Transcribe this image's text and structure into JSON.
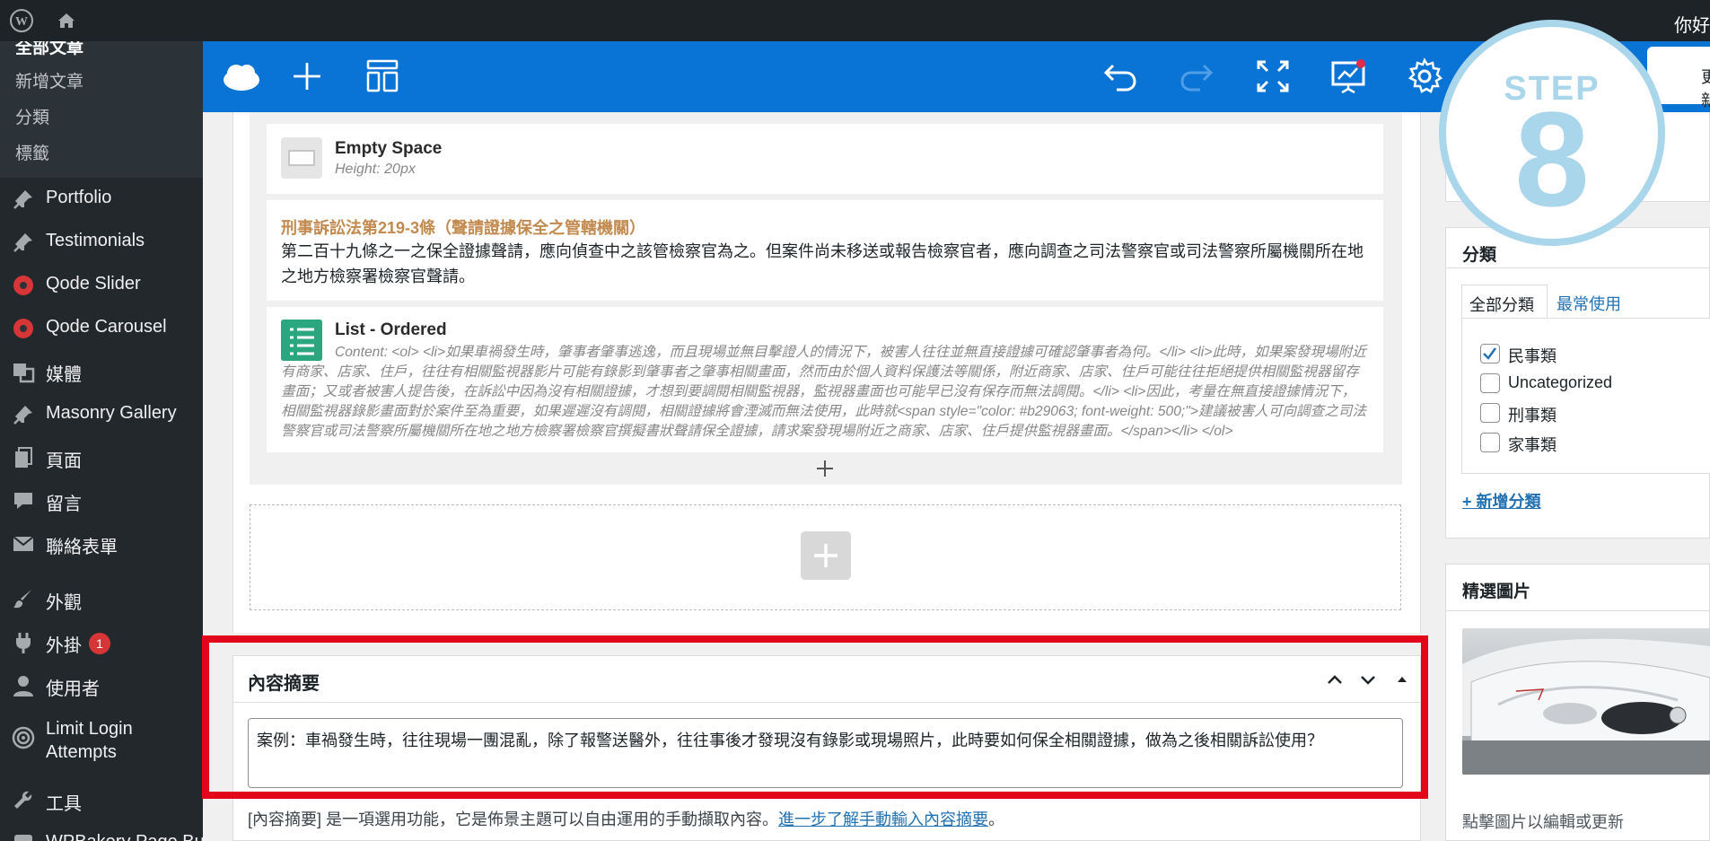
{
  "admin_bar": {
    "greeting": "你好"
  },
  "sidebar": {
    "submenu": [
      "全部文章",
      "新增文章",
      "分類",
      "標籤"
    ],
    "items": [
      {
        "label": "Portfolio",
        "icon": "pin-icon"
      },
      {
        "label": "Testimonials",
        "icon": "pin-icon"
      },
      {
        "label": "Qode Slider",
        "icon": "slider-icon"
      },
      {
        "label": "Qode Carousel",
        "icon": "slider-icon"
      },
      {
        "label": "媒體",
        "icon": "media-icon"
      },
      {
        "label": "Masonry Gallery",
        "icon": "pin-icon"
      },
      {
        "label": "頁面",
        "icon": "page-icon"
      },
      {
        "label": "留言",
        "icon": "comment-icon"
      },
      {
        "label": "聯絡表單",
        "icon": "mail-icon"
      },
      {
        "label": "外觀",
        "icon": "brush-icon"
      },
      {
        "label": "外掛",
        "icon": "plugin-icon",
        "badge": "1"
      },
      {
        "label": "使用者",
        "icon": "user-icon"
      },
      {
        "label": "Limit Login Attempts",
        "icon": "shield-icon"
      },
      {
        "label": "工具",
        "icon": "wrench-icon"
      },
      {
        "label": "WPBakery Page Builder",
        "icon": "builder-icon"
      }
    ]
  },
  "toolbar": {
    "publish_label": "更新",
    "colors": {
      "bar": "#0a73d6"
    }
  },
  "overlay": {
    "step_word": "STEP",
    "step_number": "8"
  },
  "editor": {
    "empty_space": {
      "title": "Empty Space",
      "subtitle": "Height: 20px"
    },
    "law_text": {
      "title": "刑事訴訟法第219-3條（聲請證據保全之管轄機關）",
      "body": "第二百十九條之一之保全證據聲請，應向偵查中之該管檢察官為之。但案件尚未移送或報告檢察官者，應向調查之司法警察官或司法警察所屬機關所在地之地方檢察署檢察官聲請。"
    },
    "list_ordered": {
      "title": "List - Ordered",
      "content": "Content: <ol> <li>如果車禍發生時，肇事者肇事逃逸，而且現場並無目擊證人的情況下，被害人往往並無直接證據可確認肇事者為何。</li> <li>此時，如果案發現場附近有商家、店家、住戶，往往有相關監視器影片可能有錄影到肇事者之肇事相關畫面，然而由於個人資料保護法等關係，附近商家、店家、住戶可能往往拒絕提供相關監視器留存畫面；又或者被害人提告後，在訴訟中因為沒有相關證據，才想到要調閱相關監視器，監視器畫面也可能早已沒有保存而無法調閱。</li> <li>因此，考量在無直接證據情況下，相關監視器錄影畫面對於案件至為重要，如果遲遲沒有調閱，相關證據將會湮滅而無法使用，此時就<span style=\"color: #b29063; font-weight: 500;\">建議被害人可向調查之司法警察官或司法警察所屬機關所在地之地方檢察署檢察官撰擬書狀聲請保全證據，請求案發現場附近之商家、店家、住戶提供監視器畫面。</span></li> </ol>"
    }
  },
  "excerpt": {
    "title": "內容摘要",
    "value": "案例：車禍發生時，往往現場一團混亂，除了報警送醫外，往往事後才發現沒有錄影或現場照片，此時要如何保全相關證據，做為之後相關訴訟使用？",
    "help_prefix": "[內容摘要] 是一項選用功能，它是佈景主題可以自由運用的手動擷取內容。",
    "help_link": "進一步了解手動輸入內容摘要",
    "help_suffix": "。"
  },
  "categories": {
    "title": "分類",
    "tab_all": "全部分類",
    "tab_common": "最常使用",
    "items": [
      {
        "label": "民事類",
        "checked": true
      },
      {
        "label": "Uncategorized",
        "checked": false
      },
      {
        "label": "刑事類",
        "checked": false
      },
      {
        "label": "家事類",
        "checked": false
      }
    ],
    "add_link": "+ 新增分類"
  },
  "featured": {
    "title": "精選圖片",
    "hint": "點擊圖片以編輯或更新"
  }
}
